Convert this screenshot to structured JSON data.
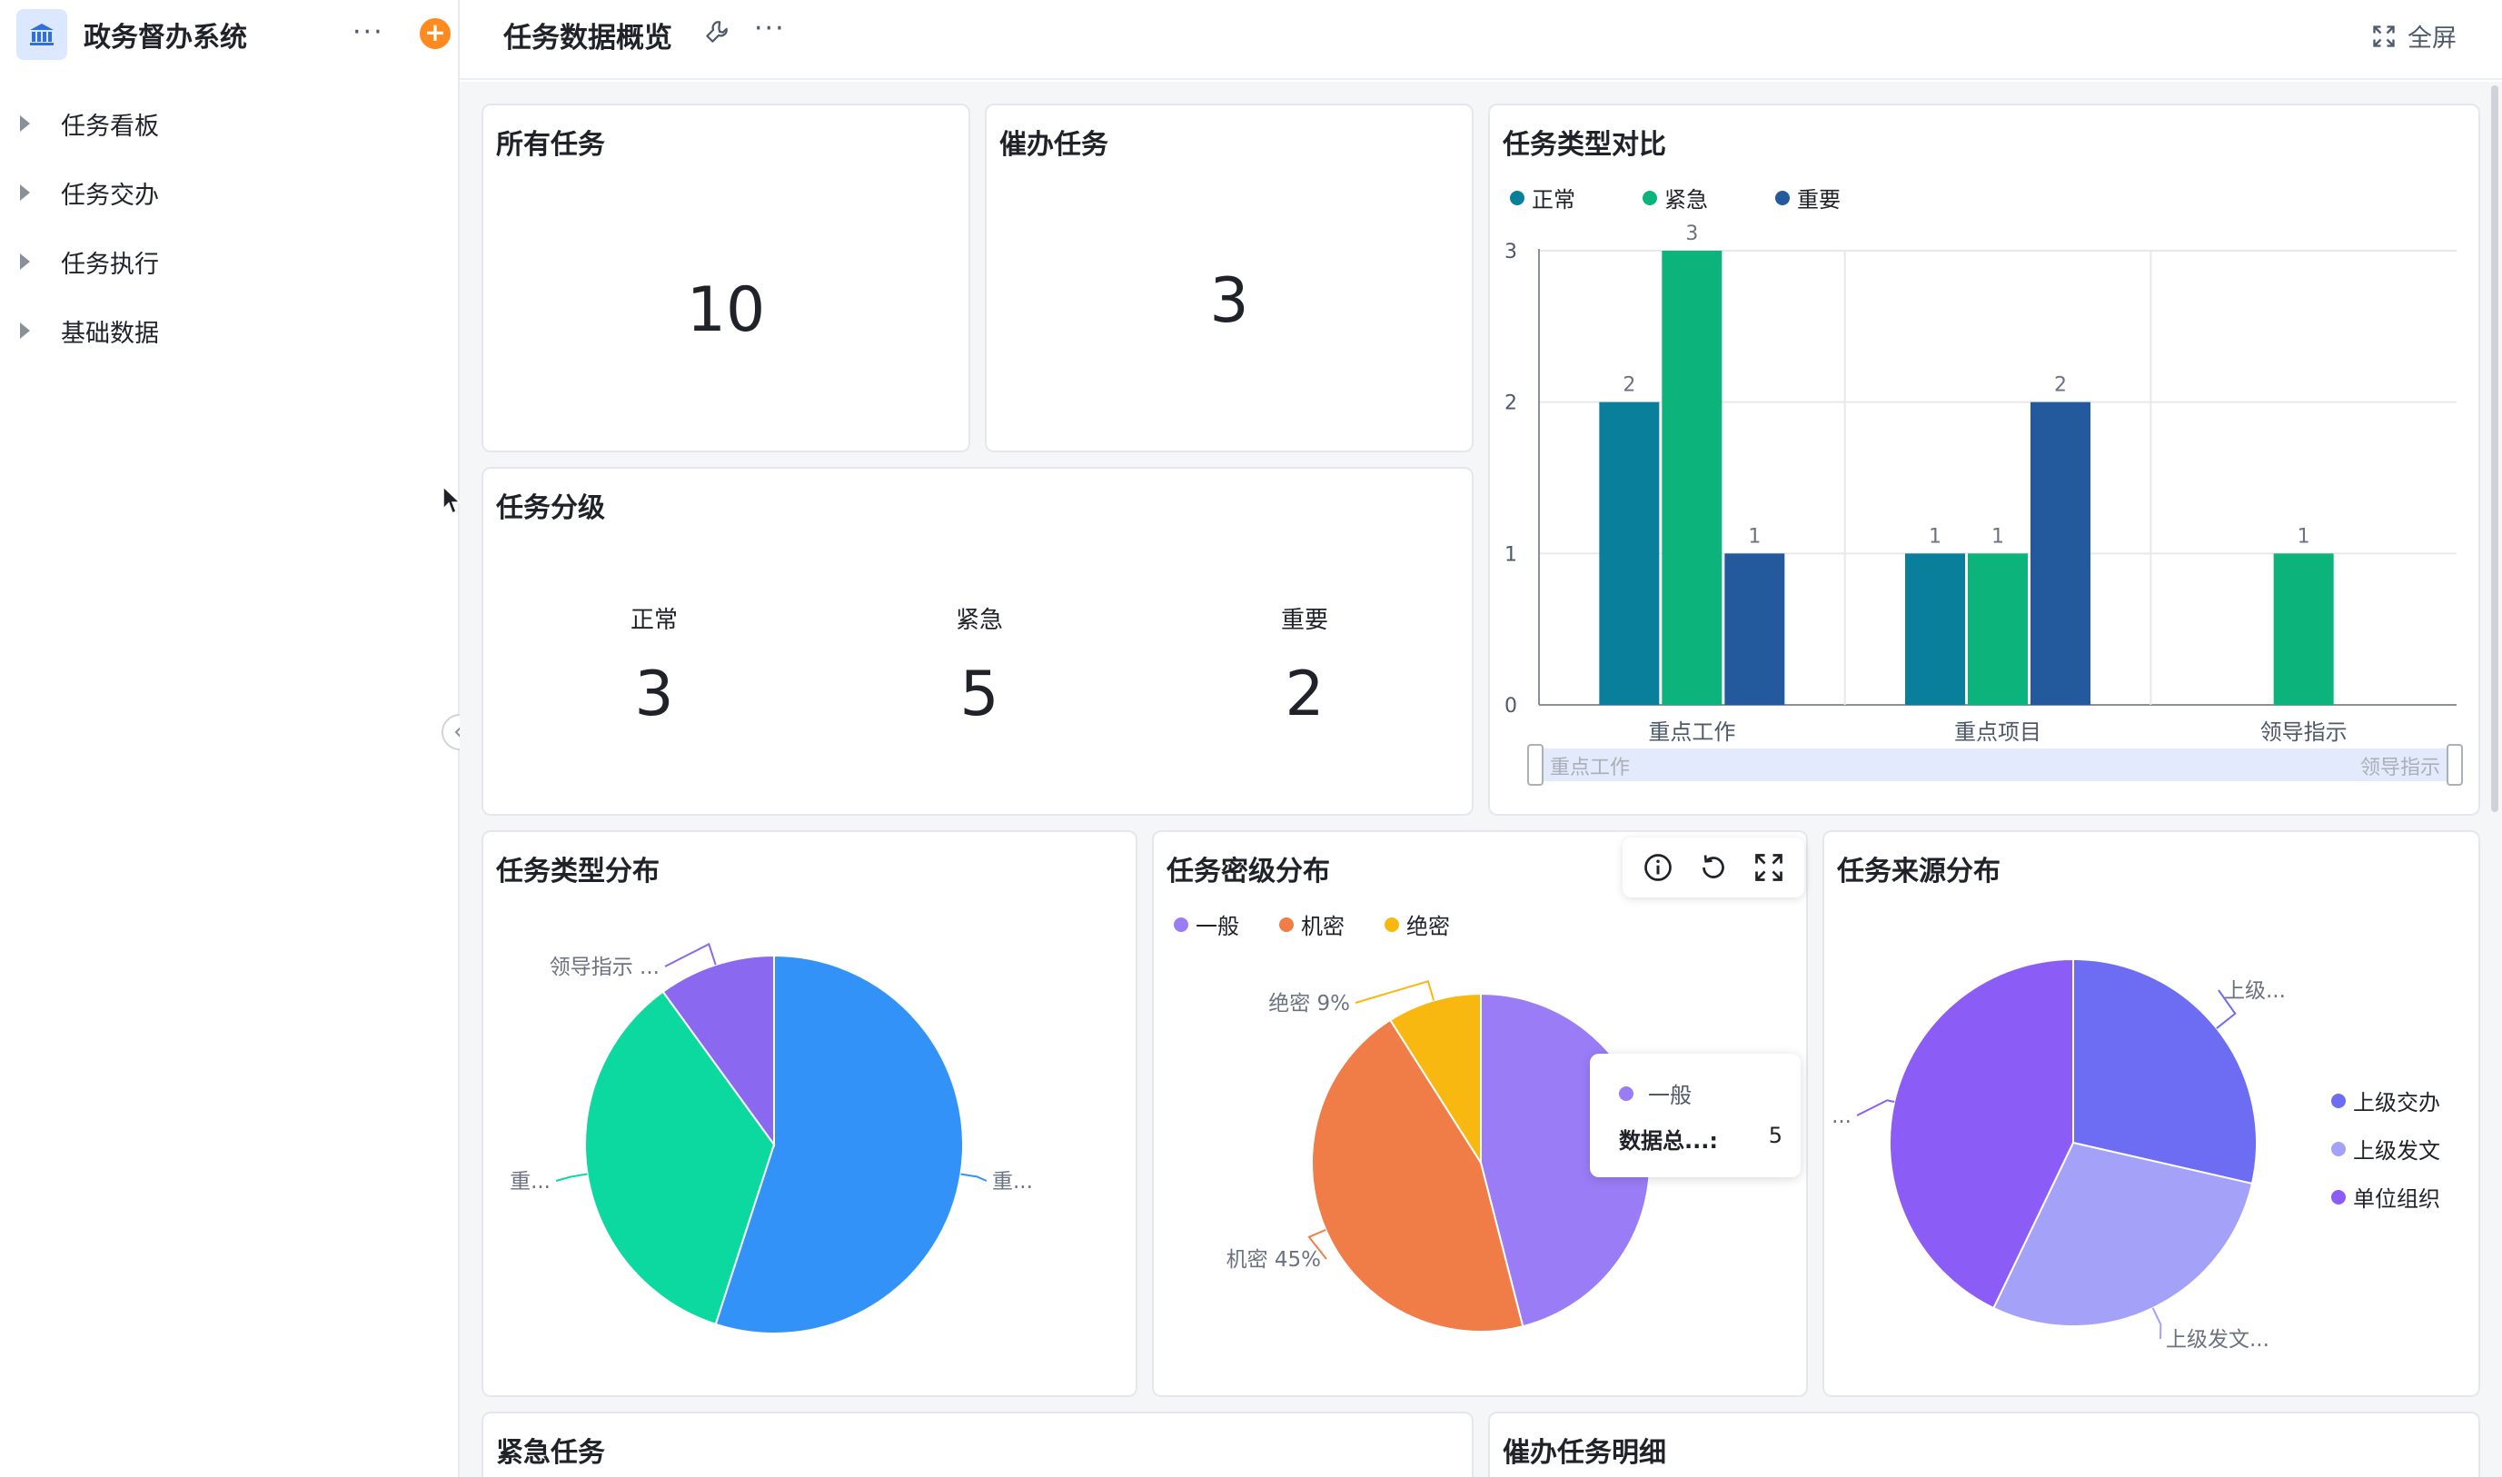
{
  "sidebar": {
    "app_title": "政务督办系统",
    "more": "···",
    "add": "+",
    "items": [
      {
        "label": "任务看板"
      },
      {
        "label": "任务交办"
      },
      {
        "label": "任务执行"
      },
      {
        "label": "基础数据"
      }
    ]
  },
  "topbar": {
    "page_title": "任务数据概览",
    "more": "···",
    "fullscreen_label": "全屏"
  },
  "cards": {
    "all_tasks": {
      "title": "所有任务",
      "value": "10"
    },
    "urge_tasks": {
      "title": "催办任务",
      "value": "3"
    },
    "grade": {
      "title": "任务分级",
      "items": [
        {
          "label": "正常",
          "value": "3"
        },
        {
          "label": "紧急",
          "value": "5"
        },
        {
          "label": "重要",
          "value": "2"
        }
      ]
    },
    "urgent_tasks": {
      "title": "紧急任务"
    },
    "urge_detail": {
      "title": "催办任务明细"
    }
  },
  "colors": {
    "normal": "#0a7f9c",
    "urgent": "#0cb47c",
    "important": "#235a9e",
    "pie_blue": "#3392f7",
    "pie_green": "#0cd9a0",
    "pie_purple": "#8b68f0",
    "secret_general": "#9a7cf6",
    "secret_confidential": "#f07d48",
    "secret_top": "#f8b810",
    "src_assign": "#6d6df4",
    "src_doc": "#a4a2f8",
    "src_org": "#8b5cf6"
  },
  "chart_data": [
    {
      "type": "bar",
      "title": "任务类型对比",
      "categories": [
        "重点工作",
        "重点项目",
        "领导指示"
      ],
      "series": [
        {
          "name": "正常",
          "values": [
            2,
            1,
            0
          ]
        },
        {
          "name": "紧急",
          "values": [
            3,
            1,
            1
          ]
        },
        {
          "name": "重要",
          "values": [
            1,
            2,
            0
          ]
        }
      ],
      "ylim": [
        0,
        3
      ],
      "yticks": [
        "0",
        "1",
        "2",
        "3"
      ],
      "legend": "top-left",
      "grid": true,
      "data_zoom": {
        "start_label": "重点工作",
        "end_label": "领导指示"
      }
    },
    {
      "type": "pie",
      "title": "任务类型分布",
      "labels": [
        "重...",
        "重...",
        "领导指示 ..."
      ],
      "values": [
        5.5,
        3.5,
        1
      ]
    },
    {
      "type": "pie",
      "title": "任务密级分布",
      "legend_items": [
        "一般",
        "机密",
        "绝密"
      ],
      "labels": [
        "",
        "机密 45%",
        "绝密 9%"
      ],
      "values": [
        46,
        45,
        9
      ],
      "legend": "top-left",
      "tooltip": {
        "series": "一般",
        "field": "数据总...:",
        "value": "5"
      }
    },
    {
      "type": "pie",
      "title": "任务来源分布",
      "legend_items": [
        "上级交办",
        "上级发文",
        "单位组织"
      ],
      "labels": [
        "上级...",
        "上级发文...",
        "..."
      ],
      "values": [
        3,
        3,
        4.5
      ],
      "legend": "right"
    }
  ]
}
